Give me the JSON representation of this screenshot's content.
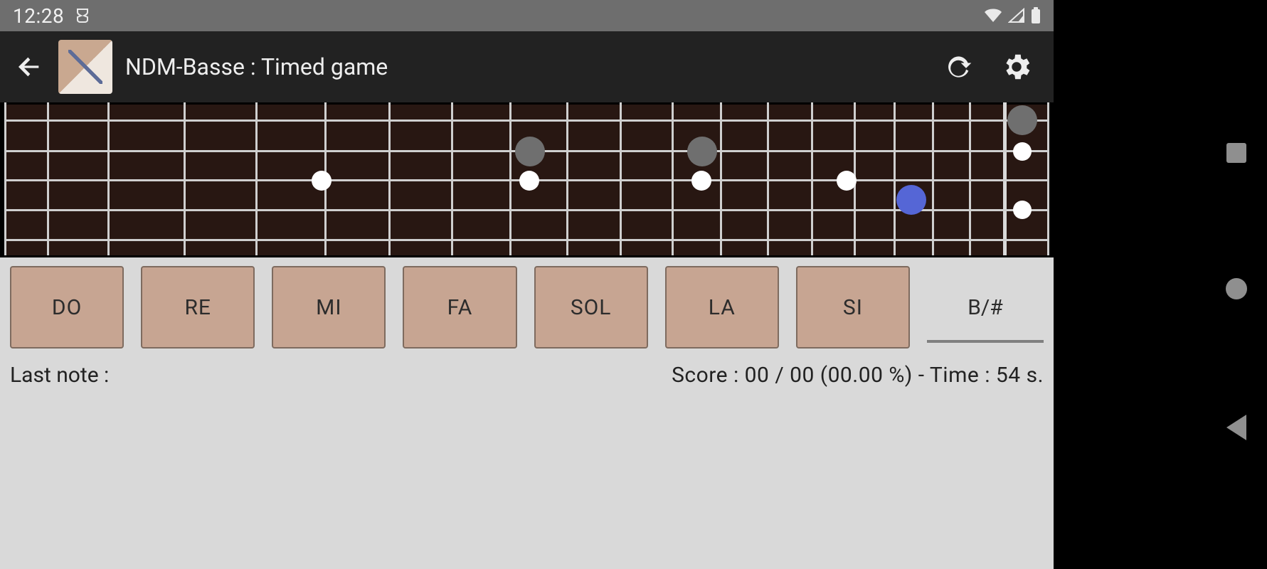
{
  "statusBar": {
    "time": "12:28"
  },
  "header": {
    "title": "NDM-Basse : Timed game"
  },
  "notes": {
    "buttons": [
      "DO",
      "RE",
      "MI",
      "FA",
      "SOL",
      "LA",
      "SI"
    ],
    "accidental": "B/#"
  },
  "footer": {
    "lastNoteLabel": "Last note :",
    "scoreText": "Score :  00 / 00 (00.00 %)  - Time :  54  s."
  }
}
